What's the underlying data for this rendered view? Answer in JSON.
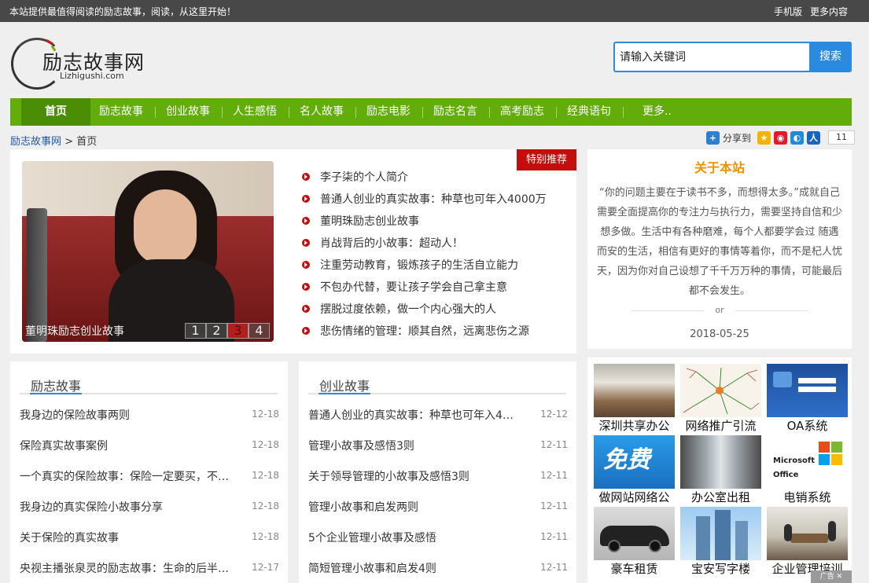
{
  "topbar": {
    "tagline": "本站提供最值得阅读的励志故事，阅读，从这里开始！",
    "links": [
      "手机版",
      "更多内容"
    ]
  },
  "logo": {
    "name": "励志故事网",
    "domain": "Lizhigushi.com"
  },
  "search": {
    "placeholder": "请输入关键词",
    "button": "搜索"
  },
  "nav": [
    "首页",
    "励志故事",
    "创业故事",
    "人生感悟",
    "名人故事",
    "励志电影",
    "励志名言",
    "高考励志",
    "经典语句",
    "更多.."
  ],
  "breadcrumb": {
    "home": "励志故事网",
    "separator": ">",
    "current": "首页"
  },
  "share": {
    "label": "分享到",
    "count": "11",
    "icons": [
      "plus-icon",
      "qzone-icon",
      "weibo-icon",
      "tencent-weibo-icon",
      "renren-icon"
    ]
  },
  "featured": {
    "badge": "特别推荐",
    "caption": "董明珠励志创业故事",
    "pager": [
      "1",
      "2",
      "3",
      "4"
    ],
    "active_page": "3",
    "items": [
      "李子柒的个人简介",
      "普通人创业的真实故事：种草也可年入4000万",
      "董明珠励志创业故事",
      "肖战背后的小故事：超动人！",
      "注重劳动教育，锻炼孩子的生活自立能力",
      "不包办代替，要让孩子学会自己拿主意",
      "摆脱过度依赖，做一个内心强大的人",
      "悲伤情绪的管理：顺其自然，远离悲伤之源"
    ]
  },
  "about": {
    "title": "关于本站",
    "text": "“你的问题主要在于读书不多，而想得太多。”成就自己需要全面提高你的专注力与执行力，需要坚持自信和少想多做。生活中有各种磨难，每个人都要学会过 随遇而安的生活，相信有更好的事情等着你，而不是杞人忧天，因为你对自己设想了千千万万种的事情，可能最后都不会发生。",
    "or": "or",
    "date": "2018-05-25"
  },
  "stories": {
    "title": "励志故事",
    "items": [
      {
        "title": "我身边的保险故事两则",
        "date": "12-18"
      },
      {
        "title": "保险真实故事案例",
        "date": "12-18"
      },
      {
        "title": "一个真实的保险故事：保险一定要买，不…",
        "date": "12-18"
      },
      {
        "title": "我身边的真实保险小故事分享",
        "date": "12-18"
      },
      {
        "title": "关于保险的真实故事",
        "date": "12-18"
      },
      {
        "title": "央视主播张泉灵的励志故事：生命的后半…",
        "date": "12-17"
      }
    ]
  },
  "startups": {
    "title": "创业故事",
    "items": [
      {
        "title": "普通人创业的真实故事：种草也可年入4…",
        "date": "12-12"
      },
      {
        "title": "管理小故事及感悟3则",
        "date": "12-11"
      },
      {
        "title": "关于领导管理的小故事及感悟3则",
        "date": "12-11"
      },
      {
        "title": "管理小故事和启发两则",
        "date": "12-11"
      },
      {
        "title": "5个企业管理小故事及感悟",
        "date": "12-11"
      },
      {
        "title": "简短管理小故事和启发4则",
        "date": "12-11"
      }
    ]
  },
  "ads": [
    {
      "label": "深圳共享办公",
      "icon": "office-photo-icon"
    },
    {
      "label": "网络推广引流",
      "icon": "mindmap-icon"
    },
    {
      "label": "OA系统",
      "icon": "login-screen-icon"
    },
    {
      "label": "做网站网络公",
      "icon": "free-banner-icon"
    },
    {
      "label": "办公室出租",
      "icon": "corridor-photo-icon"
    },
    {
      "label": "电销系统",
      "icon": "office-logo-icon"
    },
    {
      "label": "豪车租赁",
      "icon": "sports-car-icon"
    },
    {
      "label": "宝安写字楼",
      "icon": "skyscraper-icon"
    },
    {
      "label": "企业管理培训",
      "icon": "meeting-photo-icon"
    }
  ],
  "ad_banner_text": "免费",
  "ad_office_text": "Microsoft Office",
  "ad_corner": "广告 ✕"
}
